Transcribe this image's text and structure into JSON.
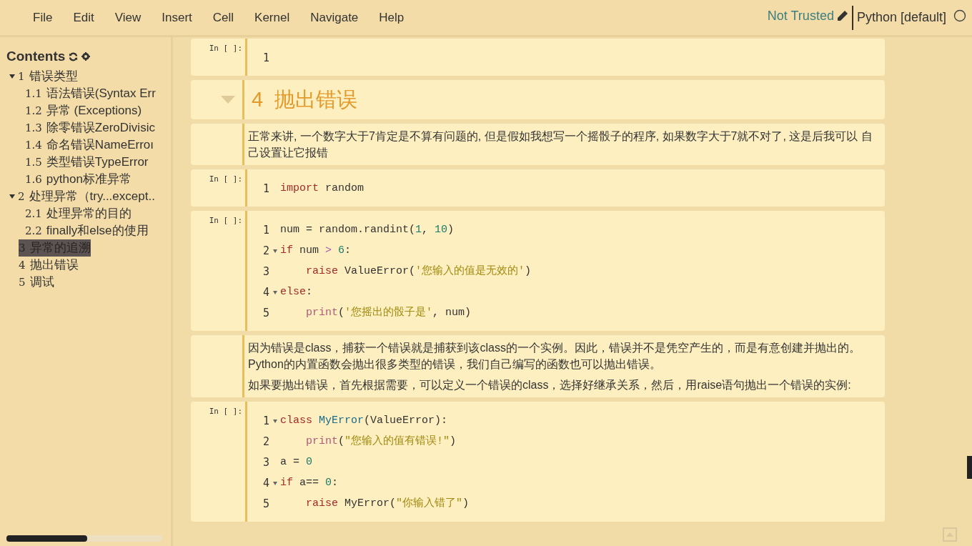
{
  "menu": [
    "File",
    "Edit",
    "View",
    "Insert",
    "Cell",
    "Kernel",
    "Navigate",
    "Help"
  ],
  "trust": {
    "label": "Not Trusted"
  },
  "kernel": {
    "name": "Python [default]",
    "busy": false
  },
  "toc": {
    "title": "Contents",
    "items": [
      {
        "number": "1",
        "label": "错误类型",
        "expanded": true,
        "selected": false,
        "children": [
          {
            "number": "1.1",
            "label": "语法错误(Syntax Err",
            "selected": false
          },
          {
            "number": "1.2",
            "label": "异常 (Exceptions)",
            "selected": false
          },
          {
            "number": "1.3",
            "label": "除零错误ZeroDivisic",
            "selected": false
          },
          {
            "number": "1.4",
            "label": "命名错误NameErroı",
            "selected": false
          },
          {
            "number": "1.5",
            "label": "类型错误TypeError",
            "selected": false
          },
          {
            "number": "1.6",
            "label": "python标准异常",
            "selected": false
          }
        ]
      },
      {
        "number": "2",
        "label": "处理异常（try...except..",
        "expanded": true,
        "selected": false,
        "children": [
          {
            "number": "2.1",
            "label": "处理异常的目的",
            "selected": false
          },
          {
            "number": "2.2",
            "label": "finally和else的使用",
            "selected": false
          }
        ]
      },
      {
        "number": "3",
        "label": "异常的追溯",
        "selected": true
      },
      {
        "number": "4",
        "label": "抛出错误",
        "selected": false
      },
      {
        "number": "5",
        "label": "调试",
        "selected": false
      }
    ]
  },
  "cells": [
    {
      "kind": "code",
      "prompt": "In [ ]:",
      "lines": [
        {
          "number": "1",
          "fold": false
        }
      ]
    },
    {
      "kind": "heading",
      "number": "4",
      "text": "抛出错误"
    },
    {
      "kind": "markdown",
      "paragraphs": [
        "正常来讲, 一个数字大于7肯定是不算有问题的, 但是假如我想写一个摇骰子的程序, 如果数字大于7就不对了, 这是后我可以 自己设置让它报错"
      ]
    },
    {
      "kind": "code",
      "prompt": "In [ ]:",
      "lines": [
        {
          "number": "1",
          "fold": false,
          "indent": false,
          "tokens": [
            {
              "kind": "keyword",
              "text": "import"
            },
            {
              "kind": "plain",
              "text": " random"
            }
          ]
        }
      ]
    },
    {
      "kind": "code",
      "prompt": "In [ ]:",
      "lines": [
        {
          "number": "1",
          "fold": false,
          "indent": false,
          "tokens": [
            {
              "kind": "plain",
              "text": "num = random.randint("
            },
            {
              "kind": "number",
              "text": "1"
            },
            {
              "kind": "plain",
              "text": ", "
            },
            {
              "kind": "number",
              "text": "10"
            },
            {
              "kind": "plain",
              "text": ")"
            }
          ]
        },
        {
          "number": "2",
          "fold": true,
          "indent": false,
          "tokens": [
            {
              "kind": "keyword",
              "text": "if"
            },
            {
              "kind": "plain",
              "text": " num "
            },
            {
              "kind": "operator",
              "text": ">"
            },
            {
              "kind": "number",
              "text": " 6"
            },
            {
              "kind": "plain",
              "text": ":"
            }
          ]
        },
        {
          "number": "3",
          "fold": false,
          "indent": true,
          "tokens": [
            {
              "kind": "keyword",
              "text": "raise"
            },
            {
              "kind": "plain",
              "text": " ValueError("
            },
            {
              "kind": "string",
              "text": "'您输入的值是无效的'"
            },
            {
              "kind": "plain",
              "text": ")"
            }
          ]
        },
        {
          "number": "4",
          "fold": true,
          "indent": false,
          "tokens": [
            {
              "kind": "keyword",
              "text": "else"
            },
            {
              "kind": "plain",
              "text": ":"
            }
          ]
        },
        {
          "number": "5",
          "fold": false,
          "indent": true,
          "tokens": [
            {
              "kind": "builtin",
              "text": "print"
            },
            {
              "kind": "plain",
              "text": "("
            },
            {
              "kind": "string",
              "text": "'您摇出的骰子是'"
            },
            {
              "kind": "plain",
              "text": ", num)"
            }
          ]
        }
      ]
    },
    {
      "kind": "markdown",
      "paragraphs": [
        "因为错误是class，捕获一个错误就是捕获到该class的一个实例。因此，错误并不是凭空产生的，而是有意创建并抛出的。Python的内置函数会抛出很多类型的错误，我们自己编写的函数也可以抛出错误。",
        "如果要抛出错误，首先根据需要，可以定义一个错误的class，选择好继承关系，然后，用raise语句抛出一个错误的实例:"
      ]
    },
    {
      "kind": "code",
      "prompt": "In [ ]:",
      "lines": [
        {
          "number": "1",
          "fold": true,
          "indent": false,
          "tokens": [
            {
              "kind": "keyword",
              "text": "class"
            },
            {
              "kind": "classname",
              "text": " MyError"
            },
            {
              "kind": "plain",
              "text": "(ValueError):"
            }
          ]
        },
        {
          "number": "2",
          "fold": false,
          "indent": true,
          "tokens": [
            {
              "kind": "builtin",
              "text": "print"
            },
            {
              "kind": "plain",
              "text": "("
            },
            {
              "kind": "string",
              "text": "\"您输入的值有错误!\""
            },
            {
              "kind": "plain",
              "text": ")"
            }
          ]
        },
        {
          "number": "3",
          "fold": false,
          "indent": false,
          "tokens": [
            {
              "kind": "plain",
              "text": "a = "
            },
            {
              "kind": "number",
              "text": "0"
            }
          ]
        },
        {
          "number": "4",
          "fold": true,
          "indent": false,
          "tokens": [
            {
              "kind": "keyword",
              "text": "if"
            },
            {
              "kind": "plain",
              "text": " a== "
            },
            {
              "kind": "number",
              "text": "0"
            },
            {
              "kind": "plain",
              "text": ":"
            }
          ]
        },
        {
          "number": "5",
          "fold": false,
          "indent": true,
          "tokens": [
            {
              "kind": "keyword",
              "text": "raise"
            },
            {
              "kind": "plain",
              "text": " MyError("
            },
            {
              "kind": "string",
              "text": "\"你输入错了\""
            },
            {
              "kind": "plain",
              "text": ")"
            }
          ]
        }
      ]
    }
  ]
}
